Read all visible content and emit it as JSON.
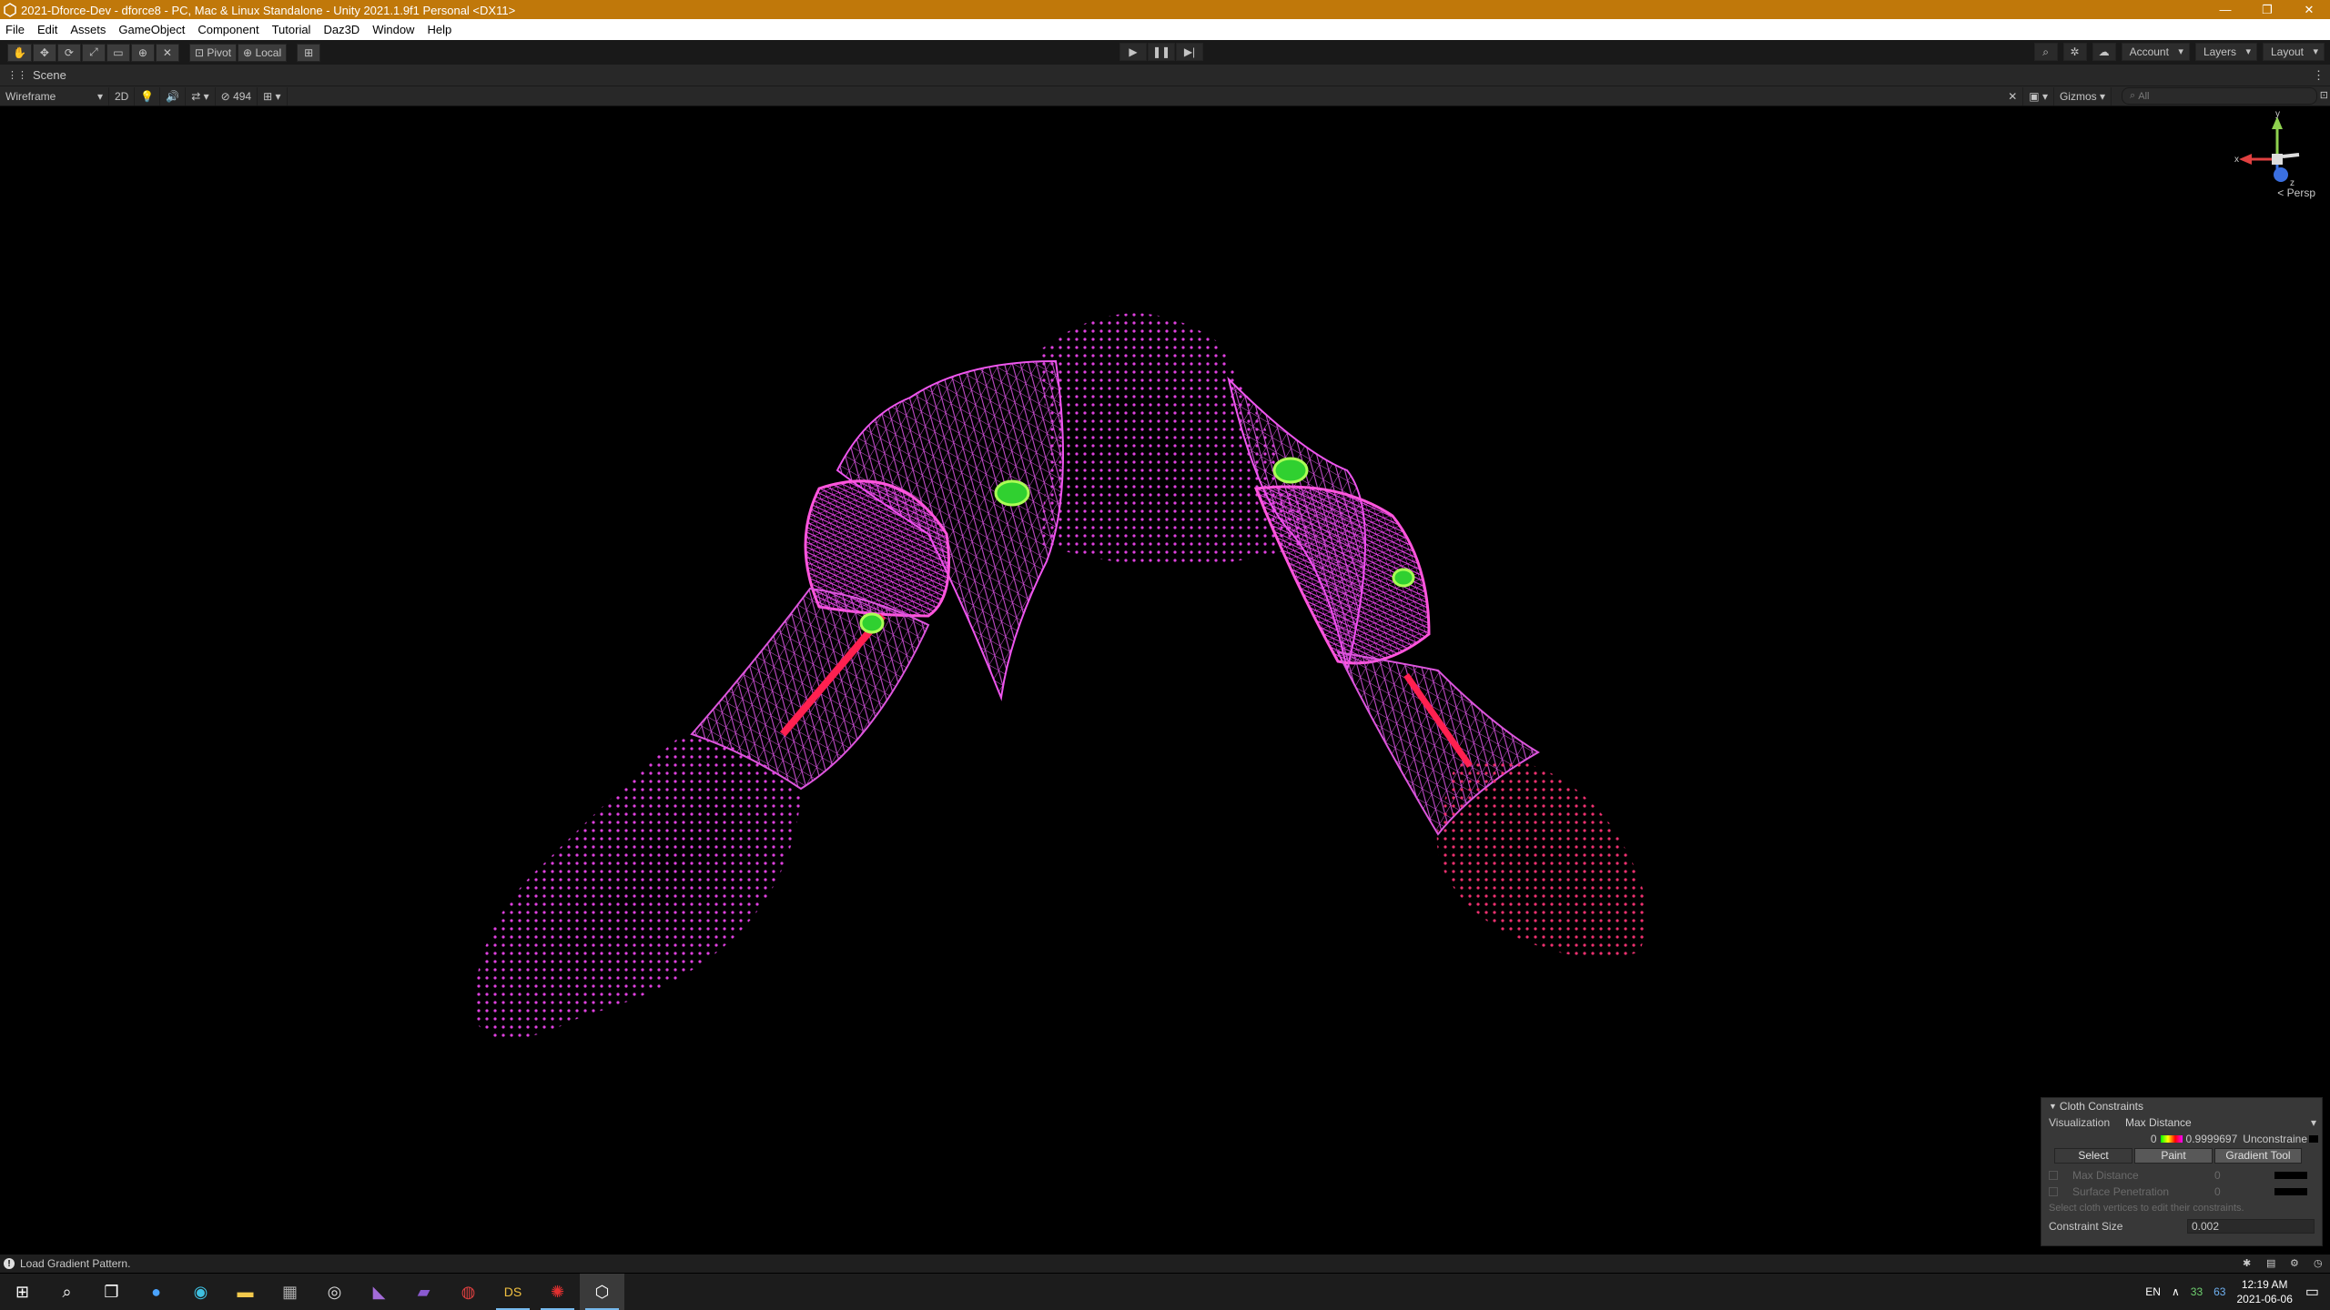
{
  "window": {
    "title": "2021-Dforce-Dev - dforce8 - PC, Mac & Linux Standalone - Unity 2021.1.9f1 Personal <DX11>",
    "minimize": "—",
    "maximize": "❐",
    "close": "✕"
  },
  "menu": [
    "File",
    "Edit",
    "Assets",
    "GameObject",
    "Component",
    "Tutorial",
    "Daz3D",
    "Window",
    "Help"
  ],
  "toolbar": {
    "pivot_label": "Pivot",
    "local_label": "Local",
    "account_label": "Account",
    "layers_label": "Layers",
    "layout_label": "Layout"
  },
  "scene": {
    "tab_label": "Scene",
    "shading_mode": "Wireframe",
    "mode_2d": "2D",
    "hidden_count": "494",
    "gizmos_label": "Gizmos",
    "search_placeholder": "All",
    "persp_label": "< Persp",
    "axis_y": "y",
    "axis_x": "x",
    "axis_z": "z"
  },
  "cloth_panel": {
    "header": "Cloth Constraints",
    "visualization_label": "Visualization",
    "visualization_value": "Max Distance",
    "range_min": "0",
    "range_max": "0.9999697",
    "unconstrained_label": "Unconstraine",
    "select_label": "Select",
    "paint_label": "Paint",
    "gradient_tool_label": "Gradient Tool",
    "max_distance_label": "Max Distance",
    "max_distance_value": "0",
    "surface_penetration_label": "Surface Penetration",
    "surface_penetration_value": "0",
    "hint": "Select cloth vertices to edit their constraints.",
    "constraint_size_label": "Constraint Size",
    "constraint_size_value": "0.002"
  },
  "status": {
    "message": "Load Gradient Pattern."
  },
  "taskbar": {
    "lang": "EN",
    "temp1": "33",
    "temp2": "63",
    "time": "12:19 AM",
    "date": "2021-06-06",
    "ds_label": "DS"
  },
  "colors": {
    "title_bar": "#c0780a",
    "wire_magenta": "#e040e0",
    "wire_red": "#ff2050",
    "wire_green": "#30e030"
  }
}
